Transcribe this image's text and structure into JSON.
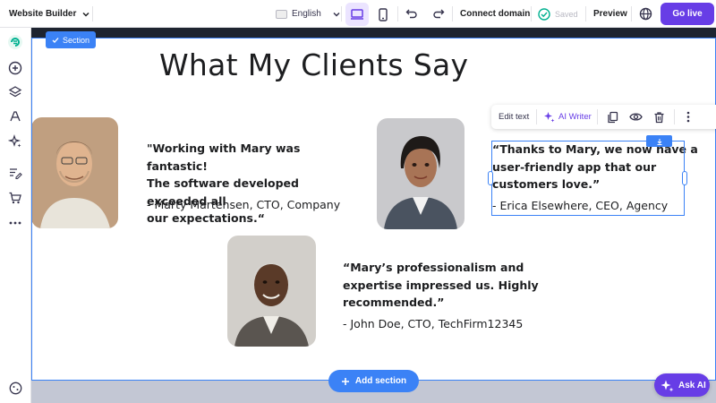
{
  "topbar": {
    "app_name": "Website Builder",
    "language": "English",
    "connect_domain": "Connect domain",
    "saved": "Saved",
    "preview": "Preview",
    "go_live": "Go live"
  },
  "canvas": {
    "section_tag": "Section",
    "heading": "What My Clients Say",
    "testimonials": [
      {
        "quote_lines": [
          "\"Working with Mary was fantastic!",
          "The software developed exceeded all",
          "our expectations.“"
        ],
        "author": "- Marty Martensen, CTO, Company"
      },
      {
        "quote_lines": [
          "“Thanks to Mary, we now have a",
          "user-friendly app that our",
          "customers love.”"
        ],
        "author": "- Erica Elsewhere, CEO, Agency"
      },
      {
        "quote_lines": [
          "“Mary’s professionalism and",
          "expertise impressed us. Highly",
          "recommended.”"
        ],
        "author": "- John Doe, CTO, TechFirm12345"
      }
    ],
    "add_section": "Add section"
  },
  "text_toolbar": {
    "edit_text": "Edit text",
    "ai_writer": "AI Writer"
  },
  "ask_ai": "Ask AI",
  "colors": {
    "accent": "#673de6",
    "selection": "#3b82f6",
    "text": "#1d1e20"
  }
}
